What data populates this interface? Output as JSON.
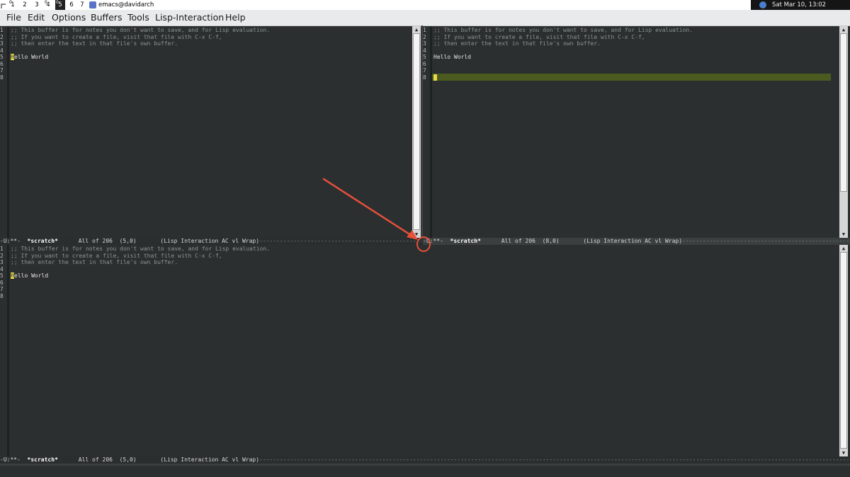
{
  "topbar": {
    "workspaces": [
      "1",
      "2",
      "3",
      "4",
      "5",
      "6",
      "7"
    ],
    "workspace_marks": [
      "0",
      "",
      "",
      "0",
      "0",
      "",
      ""
    ],
    "active_workspace": "5",
    "task_title": "emacs@davidarch",
    "clock": "Sat Mar 10, 13:02"
  },
  "menubar": {
    "items": [
      "File",
      "Edit",
      "Options",
      "Buffers",
      "Tools",
      "Lisp-Interaction",
      "Help"
    ]
  },
  "buffer": {
    "line_numbers": [
      "1",
      "2",
      "3",
      "4",
      "5",
      "6",
      "7",
      "8"
    ],
    "comment_lines": [
      ";; This buffer is for notes you don't want to save, and for Lisp evaluation.",
      ";; If you want to create a file, visit that file with C-x C-f,",
      ";; then enter the text in that file's own buffer."
    ],
    "hello_rest": "ello World",
    "hello_first": "H",
    "hello_full": "Hello World"
  },
  "modelines": {
    "left": {
      "prefix": "-U:**-  ",
      "buffer_name": "*scratch*",
      "info": "      All of 206  (5,0)       (Lisp Interaction AC vl Wrap)",
      "dashes": "------------------------------------------------------------------------"
    },
    "right": {
      "prefix": "-U:**-  ",
      "buffer_name": "*scratch*",
      "info": "      All of 206  (8,0)       (Lisp Interaction AC vl Wrap)",
      "dashes": "------------------------------------------------------------------------------------------------------------------------"
    },
    "bottom": {
      "prefix": "-U:**-  ",
      "buffer_name": "*scratch*",
      "info": "      All of 206  (5,0)       (Lisp Interaction AC vl Wrap)",
      "dashes": "---------------------------------------------------------------------------------------------------------------------------------------------------------------------------------------------------------------"
    }
  },
  "colors": {
    "annotation": "#e8503a",
    "cursor": "#e8d84a",
    "line_highlight": "#4b5b1f",
    "background": "#2b2f30"
  }
}
